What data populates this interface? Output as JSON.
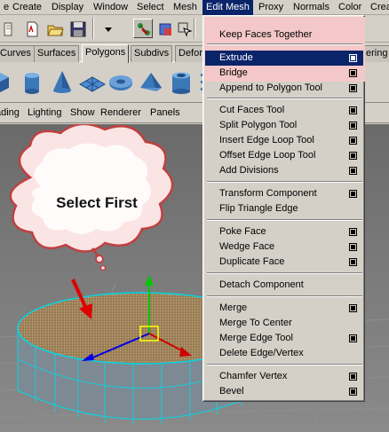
{
  "menubar": {
    "items": [
      "e",
      "Create",
      "Display",
      "Window",
      "Select",
      "Mesh",
      "Edit Mesh",
      "Proxy",
      "Normals",
      "Color",
      "Crea"
    ],
    "active_index": 6
  },
  "shelf_tabs": {
    "tabs": [
      "Curves",
      "Surfaces",
      "Polygons",
      "Subdivs",
      "Defor",
      "ering"
    ],
    "active_index": 2
  },
  "panel_menu": {
    "items": [
      "ading",
      "Lighting",
      "Show",
      "Renderer",
      "Panels"
    ]
  },
  "viewport": {
    "callout_text": "Select First"
  },
  "edit_mesh_menu": {
    "highlight_color": "#f4c8c8",
    "selection_color": "#0a246a",
    "items": [
      {
        "label": "Keep Faces Together",
        "option_box": false
      },
      {
        "label": "Extrude",
        "option_box": true,
        "selected": true
      },
      {
        "label": "Bridge",
        "option_box": true
      },
      {
        "label": "Append to Polygon Tool",
        "option_box": true
      },
      {
        "label": "Cut Faces Tool",
        "option_box": true
      },
      {
        "label": "Split Polygon Tool",
        "option_box": true
      },
      {
        "label": "Insert Edge Loop Tool",
        "option_box": true
      },
      {
        "label": "Offset Edge Loop Tool",
        "option_box": true
      },
      {
        "label": "Add Divisions",
        "option_box": true
      },
      {
        "label": "Transform Component",
        "option_box": true
      },
      {
        "label": "Flip Triangle Edge",
        "option_box": false
      },
      {
        "label": "Poke Face",
        "option_box": true
      },
      {
        "label": "Wedge Face",
        "option_box": true
      },
      {
        "label": "Duplicate Face",
        "option_box": true
      },
      {
        "label": "Detach Component",
        "option_box": false
      },
      {
        "label": "Merge",
        "option_box": true
      },
      {
        "label": "Merge To Center",
        "option_box": false
      },
      {
        "label": "Merge Edge Tool",
        "option_box": true
      },
      {
        "label": "Delete Edge/Vertex",
        "option_box": false
      },
      {
        "label": "Chamfer Vertex",
        "option_box": true
      },
      {
        "label": "Bevel",
        "option_box": true
      }
    ]
  },
  "icons": {
    "status_line": [
      "script-icon",
      "new-scene-icon",
      "open-scene-icon",
      "save-scene-icon",
      "separator",
      "select-by-hierarchy-icon",
      "select-by-object-icon",
      "select-by-component-icon",
      "separator",
      "menu-set-arrow-icon"
    ],
    "shelf": [
      "poly-cube-icon",
      "poly-cylinder-icon",
      "poly-cone-icon",
      "poly-plane-icon",
      "poly-torus-icon",
      "poly-prism-icon",
      "poly-pipe-icon",
      "poly-helix-icon"
    ],
    "manipulator": [
      "move-manipulator-icon"
    ]
  }
}
